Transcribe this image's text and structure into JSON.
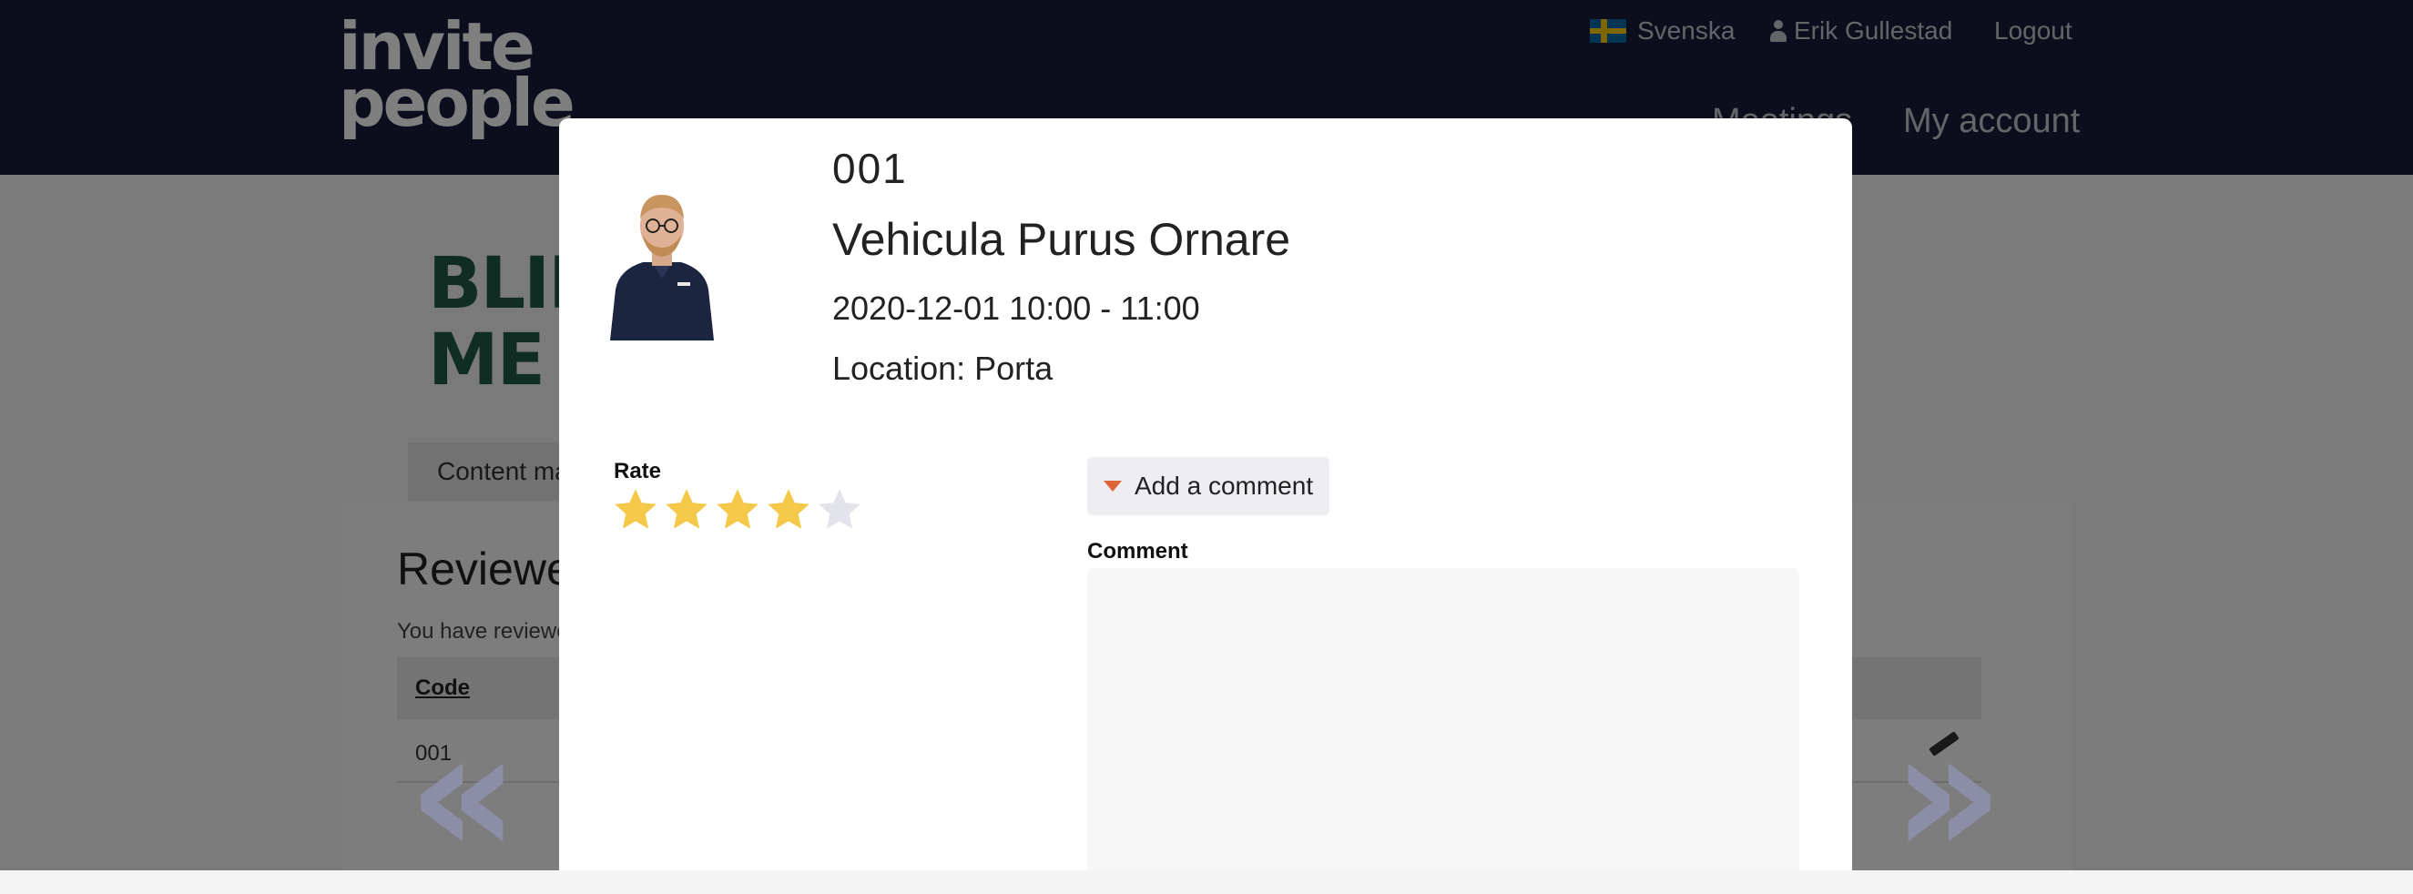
{
  "header": {
    "logo_text": "invite people",
    "top_links": {
      "language": "Svenska",
      "user": "Erik Gullestad",
      "logout": "Logout"
    },
    "main_nav": {
      "meetings": "Meetings",
      "my_account": "My account"
    }
  },
  "background_page": {
    "brand_text": "BLIP ME",
    "content_tab": "Content ma",
    "reviewed_title": "Reviewe",
    "reviewed_text": "You have reviewe",
    "table": {
      "code_header": "Code",
      "rows": [
        {
          "code": "001"
        }
      ]
    }
  },
  "modal": {
    "code": "001",
    "title": "Vehicula Purus Ornare",
    "time": "2020-12-01 10:00 - 11:00",
    "location": "Location: Porta",
    "rate_label": "Rate",
    "rating": 4,
    "rating_max": 5,
    "add_comment_label": "Add a comment",
    "comment_label": "Comment",
    "comment_value": ""
  },
  "colors": {
    "header_bg": "#191c3b",
    "star_filled": "#f4c94a",
    "star_empty": "#e3e3ec",
    "accent_caret": "#e0643a",
    "brand_green": "#1f5a46"
  },
  "icons": {
    "flag": "sweden-flag-icon",
    "user": "user-icon",
    "prev": "double-chevron-left-icon",
    "next": "double-chevron-right-icon",
    "edit": "pencil-icon"
  }
}
